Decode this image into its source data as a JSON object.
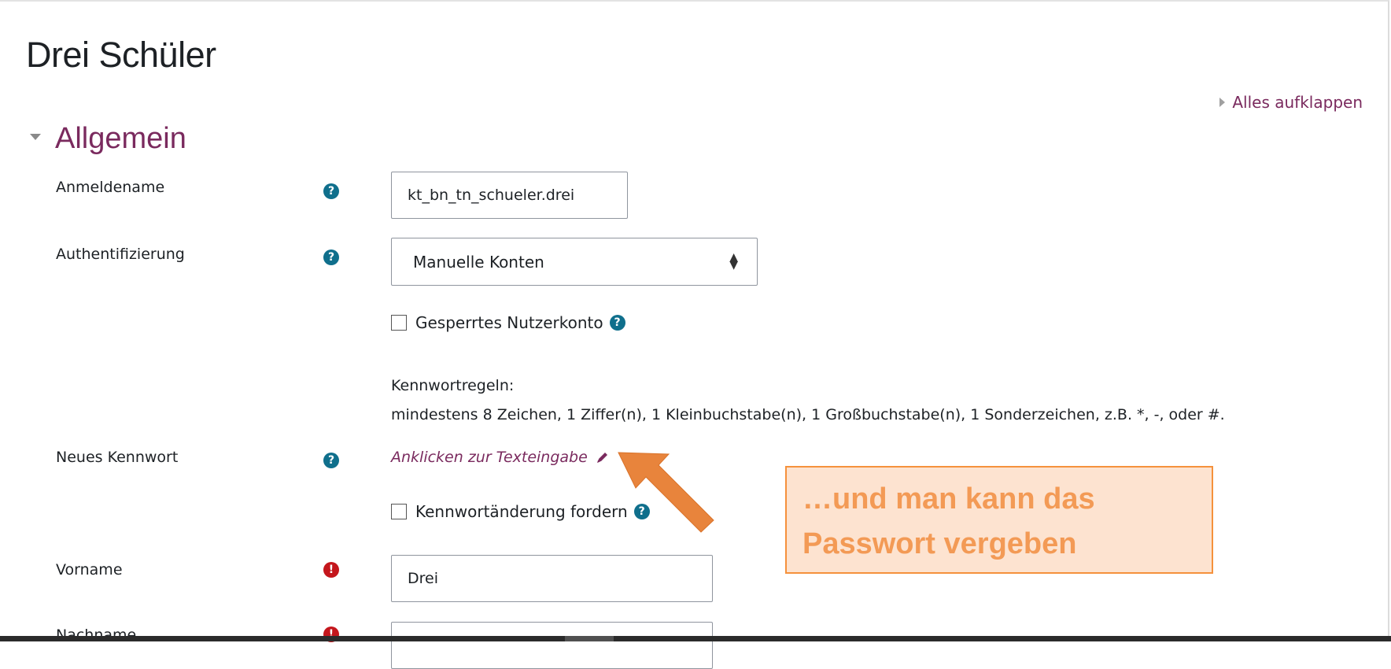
{
  "page": {
    "title": "Drei Schüler",
    "expand_all": "Alles aufklappen"
  },
  "section": {
    "title": "Allgemein"
  },
  "fields": {
    "username": {
      "label": "Anmeldename",
      "value": "kt_bn_tn_schueler.drei"
    },
    "auth": {
      "label": "Authentifizierung",
      "selected": "Manuelle Konten"
    },
    "suspended": {
      "label": "Gesperrtes Nutzerkonto",
      "checked": false
    },
    "password_rules": {
      "heading": "Kennwortregeln:",
      "text": "mindestens 8 Zeichen, 1 Ziffer(n), 1 Kleinbuchstabe(n), 1 Großbuchstabe(n), 1 Sonderzeichen, z.B. *, -, oder #."
    },
    "new_password": {
      "label": "Neues Kennwort",
      "link": "Anklicken zur Texteingabe"
    },
    "force_change": {
      "label": "Kennwortänderung fordern",
      "checked": false
    },
    "firstname": {
      "label": "Vorname",
      "value": "Drei"
    },
    "lastname": {
      "label": "Nachname",
      "value": ""
    }
  },
  "callout": {
    "line1": "…und man kann das",
    "line2": "Passwort vergeben"
  },
  "icons": {
    "help": "question-circle-icon",
    "required": "exclamation-circle-icon",
    "edit": "pencil-icon",
    "reveal": "eye-icon",
    "annotation": "arrow-icon"
  },
  "colors": {
    "accent": "#7a2a5e",
    "help": "#0f6f8c",
    "required": "#c4161c",
    "callout_border": "#f5913c",
    "callout_bg": "#fde3d0",
    "callout_text": "#f39a55",
    "arrow": "#e8843c"
  }
}
